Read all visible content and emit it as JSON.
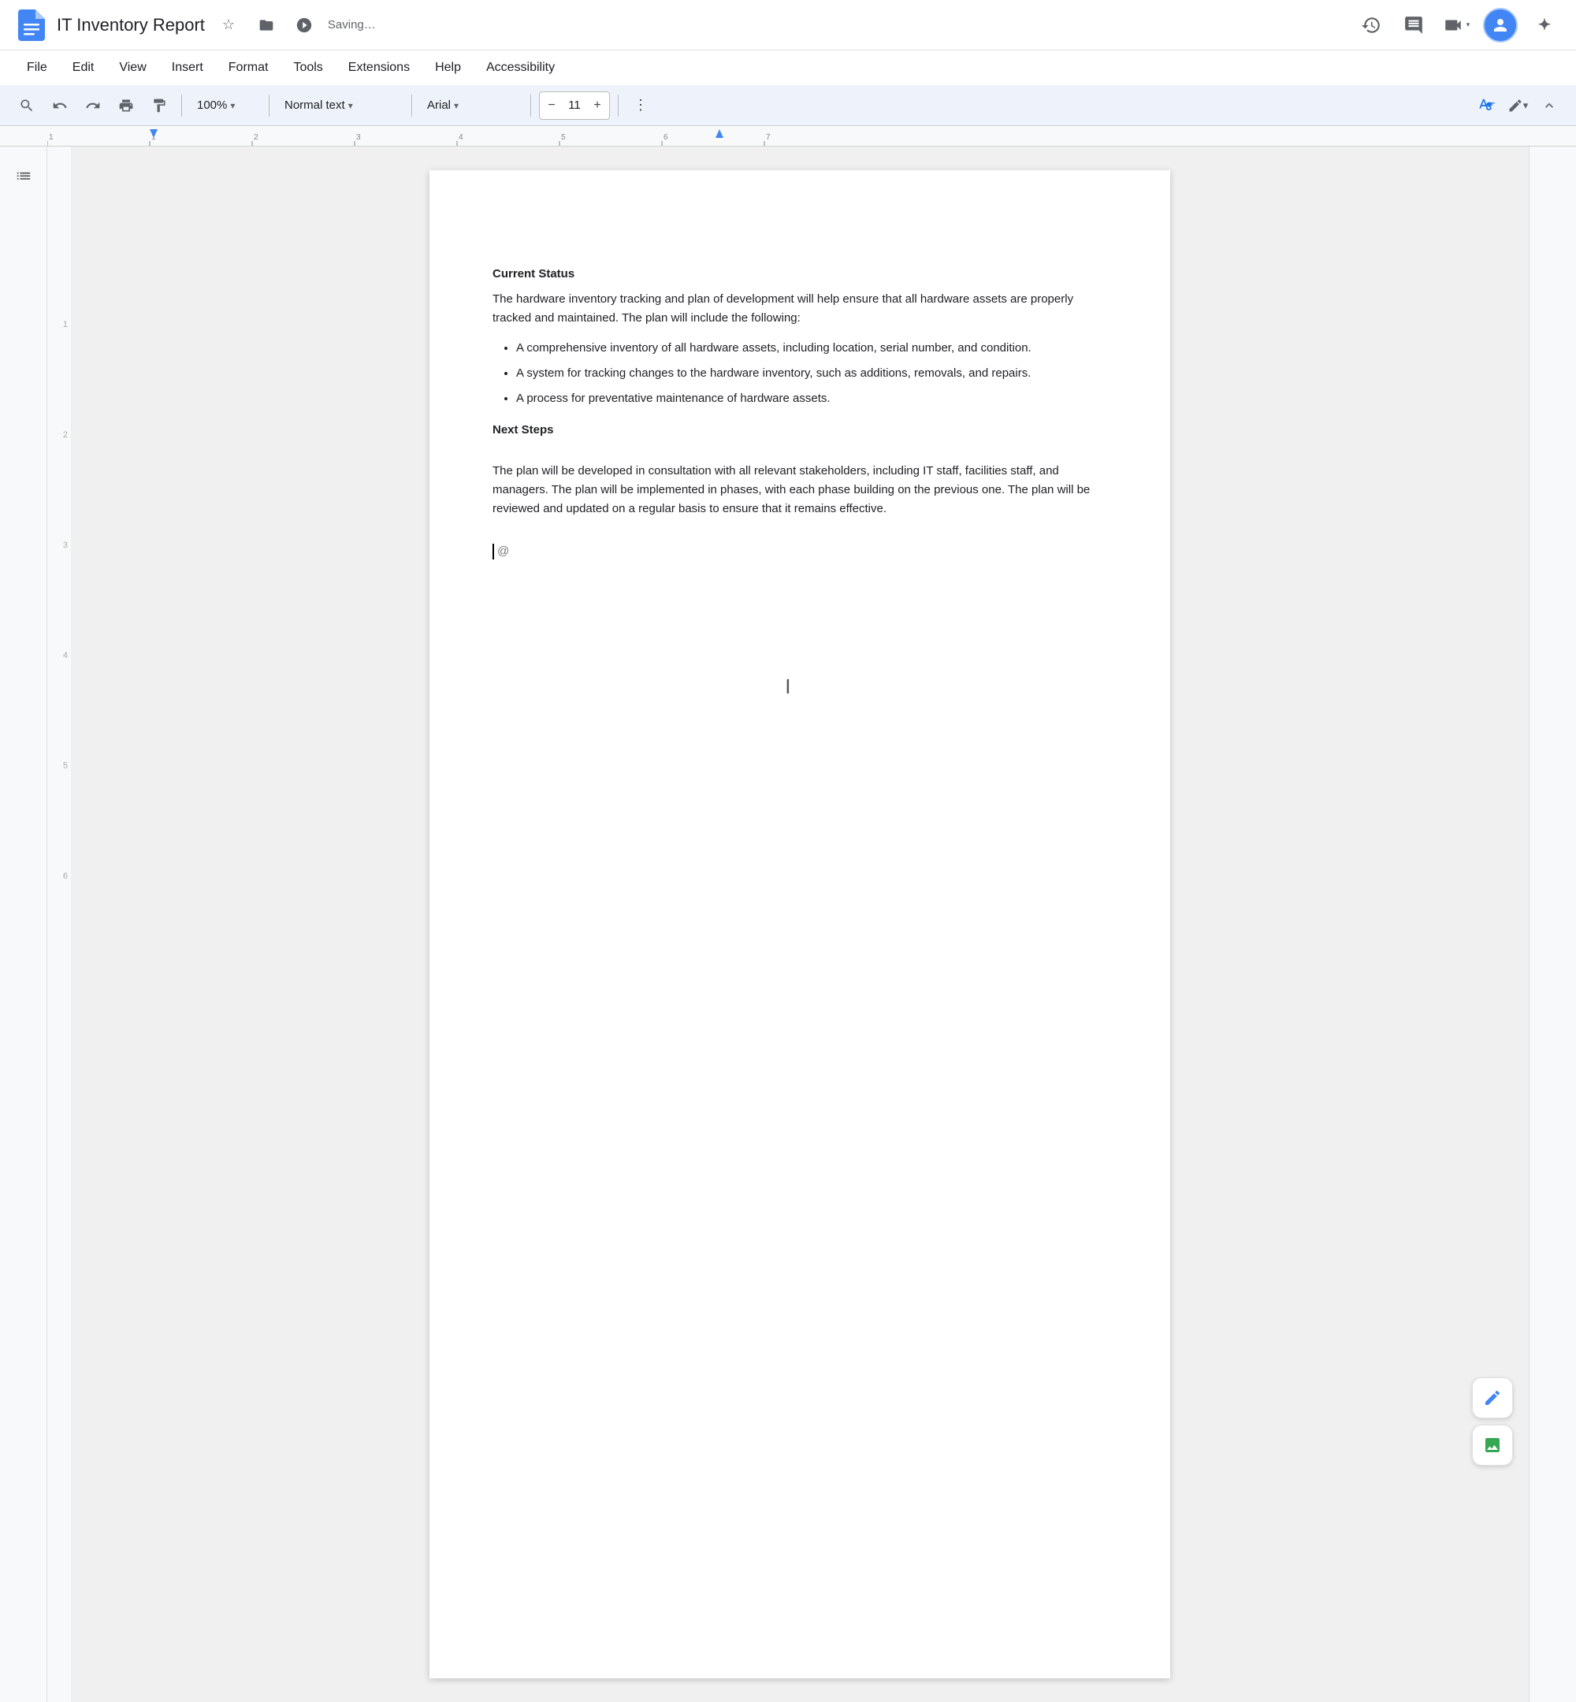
{
  "titleBar": {
    "logo": "📄",
    "docTitle": "IT Inventory Report",
    "saving": "Saving…",
    "starIcon": "☆",
    "moveIcon": "📁",
    "historyIcon": "🕐",
    "commentIcon": "💬",
    "videoIcon": "📹",
    "avatarInitial": "👤",
    "geminiIcon": "✦"
  },
  "menuBar": {
    "items": [
      "File",
      "Edit",
      "View",
      "Insert",
      "Format",
      "Tools",
      "Extensions",
      "Help",
      "Accessibility"
    ]
  },
  "toolbar": {
    "searchIcon": "🔍",
    "undoIcon": "↩",
    "redoIcon": "↪",
    "printIcon": "🖨",
    "paintFormatIcon": "🎨",
    "zoomValue": "100%",
    "styleValue": "Normal text",
    "fontValue": "Arial",
    "fontSizeValue": "11",
    "decreaseFontIcon": "−",
    "increaseFontIcon": "+",
    "moreIcon": "⋮",
    "spellcheckIcon": "A",
    "penIcon": "✏",
    "collapseIcon": "⌃"
  },
  "document": {
    "sections": [
      {
        "type": "heading",
        "text": "Current Status"
      },
      {
        "type": "paragraph",
        "text": "The hardware inventory tracking and plan of development will help ensure that all hardware assets are properly tracked and maintained. The plan will include the following:"
      },
      {
        "type": "bullets",
        "items": [
          "A comprehensive inventory of all hardware assets, including location, serial number, and condition.",
          "A system for tracking changes to the hardware inventory, such as additions, removals, and repairs.",
          "A process for preventative maintenance of hardware assets."
        ]
      },
      {
        "type": "heading",
        "text": "Next Steps"
      },
      {
        "type": "paragraph",
        "text": "The plan will be developed in consultation with all relevant stakeholders, including IT staff, facilities staff, and managers. The plan will be implemented in phases, with each phase building on the previous one. The plan will be reviewed and updated on a regular basis to ensure that it remains effective."
      }
    ],
    "cursorAt": "@"
  },
  "floatingBtns": [
    {
      "icon": "✏",
      "name": "edit-floating-btn",
      "color": "#4285f4"
    },
    {
      "icon": "⊞",
      "name": "image-floating-btn",
      "color": "#34a853"
    }
  ],
  "sidebar": {
    "listIcon": "☰"
  }
}
